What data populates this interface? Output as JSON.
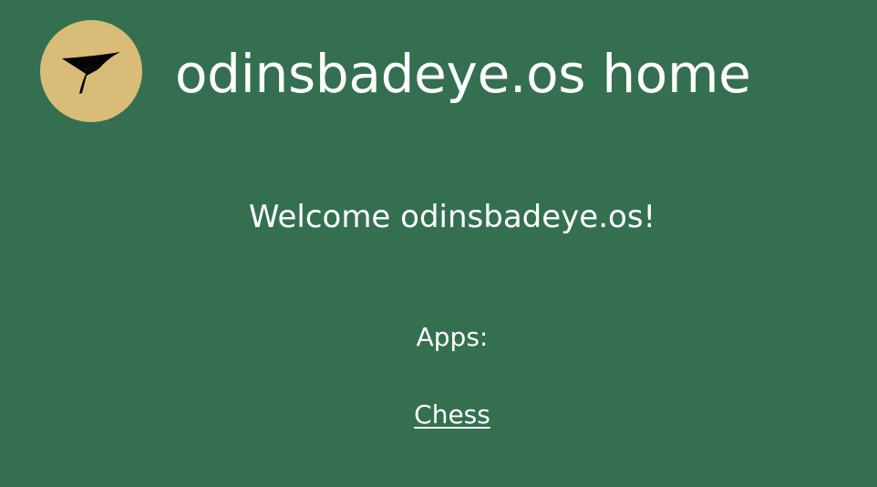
{
  "header": {
    "title": "odinsbadeye.os home",
    "logo_icon": "swift-bird-icon"
  },
  "main": {
    "welcome_text": "Welcome odinsbadeye.os!",
    "apps_heading": "Apps:",
    "apps": [
      {
        "label": "Chess"
      }
    ]
  },
  "colors": {
    "background": "#346f51",
    "logo_circle": "#d9bc77",
    "text": "#ffffff"
  }
}
